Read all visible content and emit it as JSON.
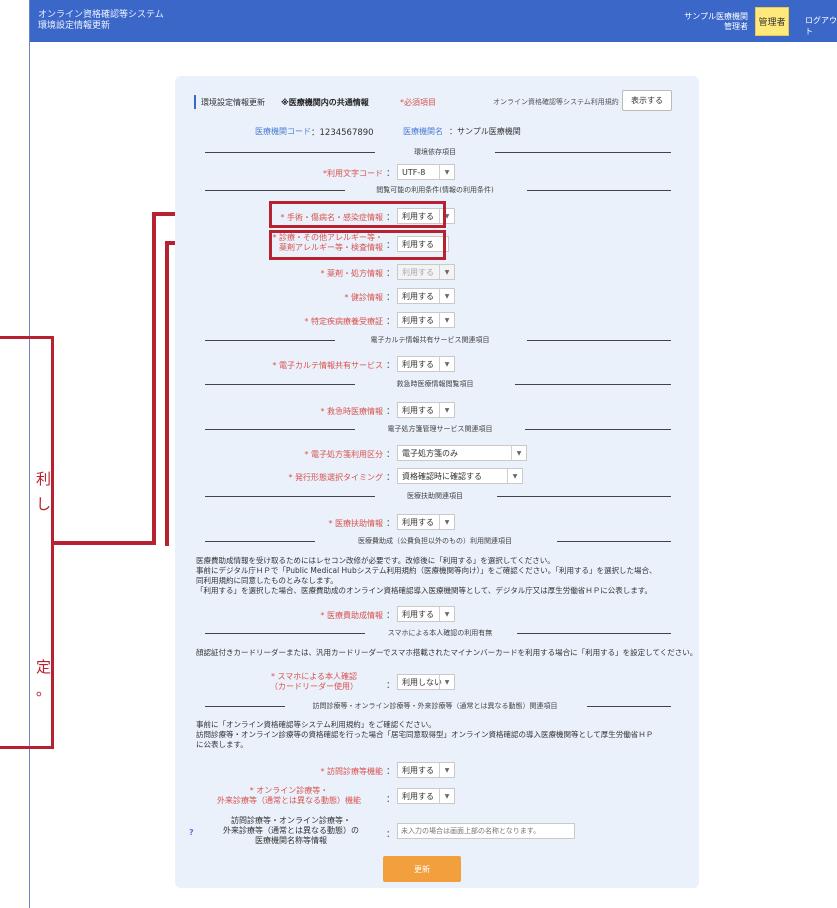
{
  "header": {
    "app_title_line1": "オンライン資格確認等システム",
    "app_title_line2": "環境設定情報更新",
    "org_name": "サンプル医療機関",
    "role": "管理者",
    "user_button": "管理者",
    "logout": "ログアウト"
  },
  "form": {
    "heading": "環境設定情報更新",
    "heading_note": "※医療機関内の共通情報",
    "required_mark": "*必須項目",
    "terms_label": "オンライン資格確認等システム利用規約",
    "terms_button": "表示する",
    "institution_code_label": "医療機関コード",
    "institution_code": "1234567890",
    "institution_name_label": "医療機関名",
    "institution_name": "サンプル医療機関",
    "sections": {
      "env": "環境依存項目",
      "viewing": "閲覧可能の利用条件(情報の利用条件)",
      "ehr": "電子カルテ情報共有サービス関連項目",
      "emergency": "救急時医療情報閲覧項目",
      "eprescription": "電子処方箋管理サービス関連項目",
      "medical_decision": "医療扶助関連項目",
      "medical_aid": "医療費助成（公費負担以外のもの）利用関連項目",
      "smartphone": "スマホによる本人確認の利用有無",
      "visiting": "訪問診療等・オンライン診療等・外来診療等（通常とは異なる動態）関連項目"
    },
    "fields": {
      "charset": {
        "label": "*利用文字コード",
        "value": "UTF-8"
      },
      "patient_info": {
        "label": "* 手術・傷病名・感染症情報",
        "value": "利用する"
      },
      "allergy": {
        "label_line1": "* 診療・その他アレルギー等・",
        "label_line2": "薬剤アレルギー等・検査情報",
        "value": "利用する"
      },
      "medication": {
        "label": "* 薬剤・処方情報",
        "value": "利用する"
      },
      "health_checkup": {
        "label": "* 健診情報",
        "value": "利用する"
      },
      "specific_checkup": {
        "label": "* 特定疾病療養受療証",
        "value": "利用する"
      },
      "ehr_share": {
        "label": "* 電子カルテ情報共有サービス",
        "value": "利用する"
      },
      "emergency_info": {
        "label": "* 救急時医療情報",
        "value": "利用する"
      },
      "eprescription_type": {
        "label": "* 電子処方箋利用区分",
        "value": "電子処方箋のみ"
      },
      "issue_timing": {
        "label": "* 発行形態選択タイミング",
        "value": "資格確認時に確認する"
      },
      "medical_decision_info": {
        "label": "* 医療扶助情報",
        "value": "利用する"
      },
      "medical_aid_info": {
        "label": "* 医療費助成情報",
        "value": "利用する"
      },
      "smartphone_check": {
        "label_line1": "* スマホによる本人確認",
        "label_line2": "（カードリーダー使用）",
        "value": "利用しない"
      },
      "visiting_care": {
        "label": "* 訪問診療等機能",
        "value": "利用する"
      },
      "online_care": {
        "label_line1": "* オンライン診療等・",
        "label_line2": "外来診療等（通常とは異なる動態）機能",
        "value": "利用する"
      },
      "facility_name": {
        "label_line1": "訪問診療等・オンライン診療等・",
        "label_line2": "外来診療等（通常とは異なる動態）の",
        "label_line3": "医療機関名称等情報",
        "placeholder": "未入力の場合は画面上部の名称となります。"
      }
    },
    "medical_aid_text": {
      "line1": "医療費助成情報を受け取るためにはレセコン改修が必要です。改修後に「利用する」を選択してください。",
      "line2": "事前にデジタル庁ＨＰで「Public Medical Hubシステム利用規約（医療機関等向け）」をご確認ください。「利用する」を選択した場合、",
      "line3": "同利用規約に同意したものとみなします。",
      "line4": "「利用する」を選択した場合、医療費助成のオンライン資格確認導入医療機関等として、デジタル庁又は厚生労働省ＨＰに公表します。"
    },
    "smartphone_text": "顔認証付きカードリーダーまたは、汎用カードリーダーでスマホ搭載されたマイナンバーカードを利用する場合に「利用する」を設定してください。",
    "visiting_text": {
      "line1": "事前に「オンライン資格確認等システム利用規約」をご確認ください。",
      "line2": "訪問診療等・オンライン診療等の資格確認を行った場合「居宅同意取得型」オンライン資格確認の導入医療機関等として厚生労働省ＨＰ",
      "line3": "に公表します。"
    },
    "help_mark": "?",
    "update_button": "更新"
  },
  "callout": {
    "text1": "利",
    "text2": "し",
    "text3": "定",
    "text4": "。"
  },
  "colors": {
    "header": "#3a67c8",
    "card": "#eaf1fb",
    "required": "#d9534f",
    "highlight": "#b8212f",
    "update_button": "#f2a03d"
  }
}
